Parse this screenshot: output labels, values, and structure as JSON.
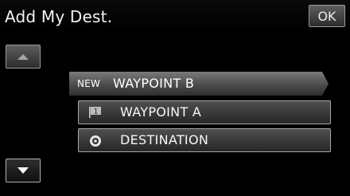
{
  "header": {
    "title": "Add My Dest.",
    "ok_label": "OK"
  },
  "list": {
    "new_item": {
      "tag": "NEW",
      "label": "WAYPOINT B"
    },
    "items": [
      {
        "label": "WAYPOINT A",
        "icon": "waypoint-flag-icon",
        "icon_number": "1"
      },
      {
        "label": "DESTINATION",
        "icon": "destination-target-icon"
      }
    ]
  },
  "scroll": {
    "up_icon": "triangle-up-icon",
    "down_icon": "triangle-down-icon"
  },
  "colors": {
    "background": "#000000",
    "button_face": "#3c3c3c",
    "button_border": "#a8a8a8",
    "text": "#ffffff"
  }
}
